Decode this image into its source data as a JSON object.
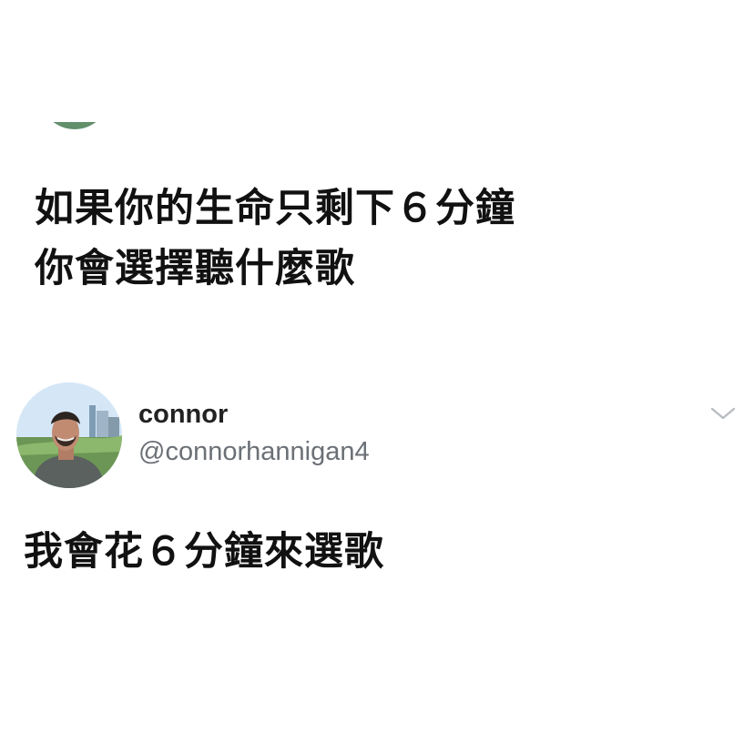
{
  "post": {
    "question_lines": [
      "如果你的生命只剩下６分鐘",
      "你會選擇聽什麼歌"
    ]
  },
  "reply": {
    "display_name": "connor",
    "handle": "@connorhannigan4",
    "text": "我會花６分鐘來選歌",
    "more_icon": "chevron-down-icon"
  },
  "colors": {
    "background": "#ffffff",
    "text": "#111111",
    "handle": "#6b7076",
    "chevron": "#b8bcc2",
    "avatar_accent": "#5a8a63"
  }
}
